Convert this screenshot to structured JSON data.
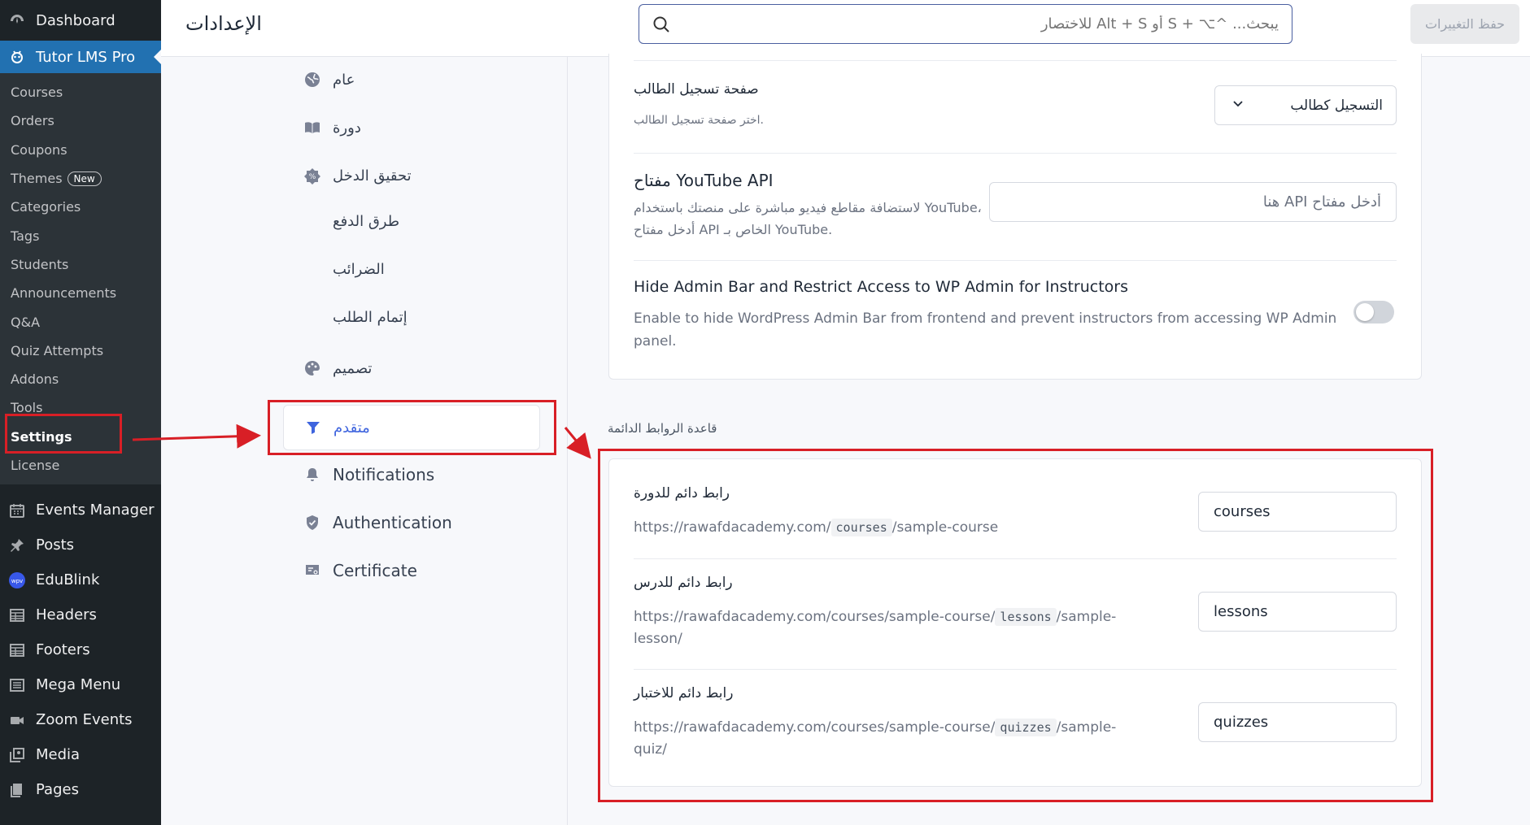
{
  "wp_sidebar": {
    "top_items": [
      {
        "label": "Dashboard",
        "icon": "dashboard-icon"
      },
      {
        "label": "Tutor LMS Pro",
        "icon": "tutor-icon"
      }
    ],
    "submenu": [
      {
        "label": "Courses"
      },
      {
        "label": "Orders"
      },
      {
        "label": "Coupons"
      },
      {
        "label": "Themes",
        "badge": "New"
      },
      {
        "label": "Categories"
      },
      {
        "label": "Tags"
      },
      {
        "label": "Students"
      },
      {
        "label": "Announcements"
      },
      {
        "label": "Q&A"
      },
      {
        "label": "Quiz Attempts"
      },
      {
        "label": "Addons"
      },
      {
        "label": "Tools"
      },
      {
        "label": "Settings"
      },
      {
        "label": "License"
      }
    ],
    "bottom_items": [
      {
        "label": "Events Manager",
        "icon": "calendar-icon"
      },
      {
        "label": "Posts",
        "icon": "pin-icon"
      },
      {
        "label": "EduBlink",
        "icon": "wpv-icon"
      },
      {
        "label": "Headers",
        "icon": "grid-icon"
      },
      {
        "label": "Footers",
        "icon": "grid-icon"
      },
      {
        "label": "Mega Menu",
        "icon": "list-icon"
      },
      {
        "label": "Zoom Events",
        "icon": "video-icon"
      },
      {
        "label": "Media",
        "icon": "media-icon"
      },
      {
        "label": "Pages",
        "icon": "page-icon"
      }
    ]
  },
  "header": {
    "title": "الإعدادات",
    "search_placeholder": "يبحث... ^⌥ + S أو Alt + S للاختصار",
    "save_label": "حفظ التغييرات"
  },
  "settings_nav": [
    {
      "label": "عام",
      "icon": "globe-icon"
    },
    {
      "label": "دورة",
      "icon": "book-icon"
    },
    {
      "label": "تحقيق الدخل",
      "icon": "monetization-icon"
    },
    {
      "label": "طرق الدفع",
      "icon": ""
    },
    {
      "label": "الضرائب",
      "icon": ""
    },
    {
      "label": "إتمام الطلب",
      "icon": ""
    },
    {
      "label": "تصميم",
      "icon": "palette-icon"
    },
    {
      "label": "متقدم",
      "icon": "filter-icon"
    },
    {
      "label": "Notifications",
      "icon": "bell-icon"
    },
    {
      "label": "Authentication",
      "icon": "shield-icon"
    },
    {
      "label": "Certificate",
      "icon": "certificate-icon"
    }
  ],
  "settings": {
    "student_registration": {
      "title": "صفحة تسجيل الطالب",
      "desc": "اختر صفحة تسجيل الطالب.",
      "value": "التسجيل كطالب"
    },
    "youtube_api": {
      "title": "مفتاح YouTube API",
      "desc_line1": "لاستضافة مقاطع فيديو مباشرة على منصتك باستخدام YouTube،",
      "desc_line2": "أدخل مفتاح API الخاص بـ YouTube.",
      "placeholder": "أدخل مفتاح API هنا"
    },
    "hide_admin_bar": {
      "title": "Hide Admin Bar and Restrict Access to WP Admin for Instructors",
      "desc_line1": "Enable to hide WordPress Admin Bar from frontend and prevent instructors from accessing WP Admin",
      "desc_line2": "panel.",
      "enabled": false
    }
  },
  "permalinks": {
    "section_label": "قاعدة الروابط الدائمة",
    "course": {
      "title": "رابط دائم للدورة",
      "url_prefix": "https://rawafdacademy.com/",
      "slug": "courses",
      "url_suffix": "/sample-course",
      "value": "courses"
    },
    "lesson": {
      "title": "رابط دائم للدرس",
      "url_prefix": "https://rawafdacademy.com/courses/sample-course/",
      "slug": "lessons",
      "url_suffix": "/sample-",
      "url_line2": "lesson/",
      "value": "lessons"
    },
    "quiz": {
      "title": "رابط دائم للاختبار",
      "url_prefix": "https://rawafdacademy.com/courses/sample-course/",
      "slug": "quizzes",
      "url_suffix": "/sample-",
      "url_line2": "quiz/",
      "value": "quizzes"
    }
  },
  "colors": {
    "accent": "#3e64de",
    "wp_sidebar": "#1d2327",
    "wp_current": "#2271b1",
    "annotation_red": "#d81f26"
  }
}
